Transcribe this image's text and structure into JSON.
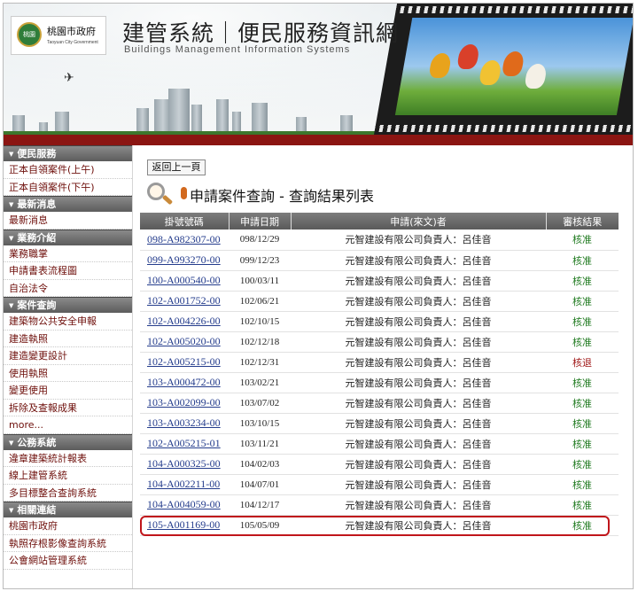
{
  "banner": {
    "logo_text": "桃園市政府",
    "logo_sub": "Taoyuan City Government",
    "logo_seal": "桃園",
    "title": "建管系統｜便民服務資訊網",
    "subtitle": "Buildings Management Information Systems"
  },
  "sidebar": {
    "sections": [
      {
        "title": "便民服務",
        "items": [
          "正本自領案件(上午)",
          "正本自領案件(下午)"
        ]
      },
      {
        "title": "最新消息",
        "items": [
          "最新消息"
        ]
      },
      {
        "title": "業務介紹",
        "items": [
          "業務職掌",
          "申請書表流程圖",
          "自治法令"
        ]
      },
      {
        "title": "案件查詢",
        "items": [
          "建築物公共安全申報",
          "建造執照",
          "建造變更設計",
          "使用執照",
          "變更使用",
          "拆除及查報成果",
          "more..."
        ]
      },
      {
        "title": "公務系統",
        "items": [
          "違章建築統計報表",
          "線上建管系統",
          "多目標整合查詢系統"
        ]
      },
      {
        "title": "相關連結",
        "items": [
          "桃園市政府",
          "執照存根影像查詢系統",
          "公會網站管理系統"
        ]
      }
    ]
  },
  "main": {
    "back_label": "返回上一頁",
    "title": "申請案件查詢 - 查詢結果列表",
    "columns": [
      "掛號號碼",
      "申請日期",
      "申請(來文)者",
      "審核結果"
    ],
    "rows": [
      {
        "no": "098-A982307-00",
        "date": "098/12/29",
        "applicant": "元智建設有限公司負責人：呂佳音",
        "result": "核准"
      },
      {
        "no": "099-A993270-00",
        "date": "099/12/23",
        "applicant": "元智建設有限公司負責人：呂佳音",
        "result": "核准"
      },
      {
        "no": "100-A000540-00",
        "date": "100/03/11",
        "applicant": "元智建設有限公司負責人：呂佳音",
        "result": "核准"
      },
      {
        "no": "102-A001752-00",
        "date": "102/06/21",
        "applicant": "元智建設有限公司負責人：呂佳音",
        "result": "核准"
      },
      {
        "no": "102-A004226-00",
        "date": "102/10/15",
        "applicant": "元智建設有限公司負責人：呂佳音",
        "result": "核准"
      },
      {
        "no": "102-A005020-00",
        "date": "102/12/18",
        "applicant": "元智建設有限公司負責人：呂佳音",
        "result": "核准"
      },
      {
        "no": "102-A005215-00",
        "date": "102/12/31",
        "applicant": "元智建設有限公司負責人：呂佳音",
        "result": "核退"
      },
      {
        "no": "103-A000472-00",
        "date": "103/02/21",
        "applicant": "元智建設有限公司負責人：呂佳音",
        "result": "核准"
      },
      {
        "no": "103-A002099-00",
        "date": "103/07/02",
        "applicant": "元智建設有限公司負責人：呂佳音",
        "result": "核准"
      },
      {
        "no": "103-A003234-00",
        "date": "103/10/15",
        "applicant": "元智建設有限公司負責人：呂佳音",
        "result": "核准"
      },
      {
        "no": "102-A005215-01",
        "date": "103/11/21",
        "applicant": "元智建設有限公司負責人：呂佳音",
        "result": "核准"
      },
      {
        "no": "104-A000325-00",
        "date": "104/02/03",
        "applicant": "元智建設有限公司負責人：呂佳音",
        "result": "核准"
      },
      {
        "no": "104-A002211-00",
        "date": "104/07/01",
        "applicant": "元智建設有限公司負責人：呂佳音",
        "result": "核准"
      },
      {
        "no": "104-A004059-00",
        "date": "104/12/17",
        "applicant": "元智建設有限公司負責人：呂佳音",
        "result": "核准"
      },
      {
        "no": "105-A001169-00",
        "date": "105/05/09",
        "applicant": "元智建設有限公司負責人：呂佳音",
        "result": "核准"
      }
    ]
  },
  "colors": {
    "accent": "#8b1512",
    "link": "#243c8c",
    "status_ok": "#1f7a1f",
    "status_back": "#a01818",
    "highlight": "#c0161b"
  }
}
